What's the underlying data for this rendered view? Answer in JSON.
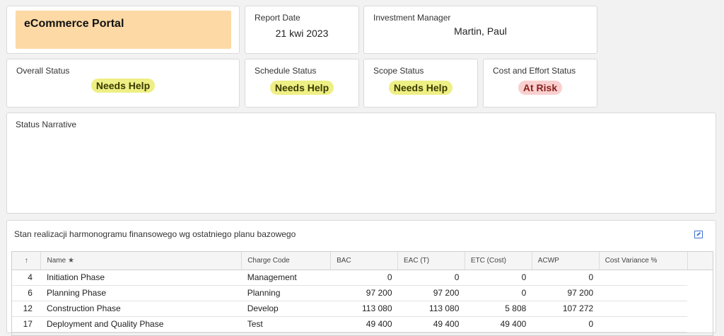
{
  "project": {
    "title": "eCommerce Portal"
  },
  "report_date": {
    "label": "Report Date",
    "value": "21 kwi 2023"
  },
  "investment_manager": {
    "label": "Investment Manager",
    "value": "Martin, Paul"
  },
  "overall_status": {
    "label": "Overall Status",
    "value": "Needs Help",
    "color": "#eeef84"
  },
  "schedule_status": {
    "label": "Schedule Status",
    "value": "Needs Help",
    "color": "#eeef84"
  },
  "scope_status": {
    "label": "Scope Status",
    "value": "Needs Help",
    "color": "#eeef84"
  },
  "cost_status": {
    "label": "Cost and Effort Status",
    "value": "At Risk",
    "color": "#f9d0cf"
  },
  "narrative": {
    "label": "Status Narrative"
  },
  "schedule_table": {
    "title": "Stan realizacji harmonogramu finansowego wg ostatniego planu bazowego",
    "edit_icon": "edit-icon",
    "columns": {
      "sort": "↑",
      "name": "Name",
      "name_star": "★",
      "charge_code": "Charge Code",
      "bac": "BAC",
      "eac": "EAC (T)",
      "etc": "ETC (Cost)",
      "acwp": "ACWP",
      "cv": "Cost Variance %"
    },
    "rows": [
      {
        "id": "4",
        "name": "Initiation Phase",
        "charge_code": "Management",
        "bac": "0",
        "eac": "0",
        "etc": "0",
        "acwp": "0",
        "cv": ""
      },
      {
        "id": "6",
        "name": "Planning Phase",
        "charge_code": "Planning",
        "bac": "97 200",
        "eac": "97 200",
        "etc": "0",
        "acwp": "97 200",
        "cv": ""
      },
      {
        "id": "12",
        "name": "Construction Phase",
        "charge_code": "Develop",
        "bac": "113 080",
        "eac": "113 080",
        "etc": "5 808",
        "acwp": "107 272",
        "cv": ""
      },
      {
        "id": "17",
        "name": "Deployment and Quality Phase",
        "charge_code": "Test",
        "bac": "49 400",
        "eac": "49 400",
        "etc": "49 400",
        "acwp": "0",
        "cv": ""
      }
    ]
  }
}
